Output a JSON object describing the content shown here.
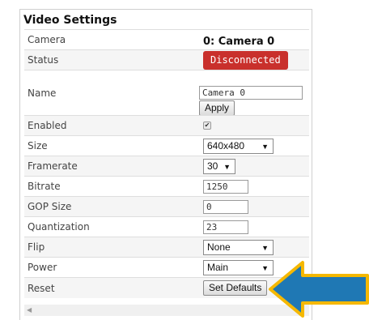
{
  "panel": {
    "title": "Video Settings",
    "rows": {
      "camera": {
        "label": "Camera",
        "value": "0: Camera 0"
      },
      "status": {
        "label": "Status",
        "value": "Disconnected"
      },
      "name": {
        "label": "Name",
        "value": "Camera 0",
        "apply_label": "Apply"
      },
      "enabled": {
        "label": "Enabled",
        "checked": true,
        "check_glyph": "✔"
      },
      "size": {
        "label": "Size",
        "value": "640x480"
      },
      "framerate": {
        "label": "Framerate",
        "value": "30"
      },
      "bitrate": {
        "label": "Bitrate",
        "value": "1250"
      },
      "gop": {
        "label": "GOP Size",
        "value": "0"
      },
      "quantization": {
        "label": "Quantization",
        "value": "23"
      },
      "flip": {
        "label": "Flip",
        "value": "None"
      },
      "power": {
        "label": "Power",
        "value": "Main"
      },
      "reset": {
        "label": "Reset",
        "button_label": "Set Defaults"
      }
    },
    "scroll_left_glyph": "◀",
    "dropdown_glyph": "▼"
  },
  "icons": {
    "dropdown": "chevron-down-icon",
    "checkbox": "checkmark-icon",
    "scroll": "scroll-left-icon",
    "annotation": "arrow-left-icon"
  },
  "colors": {
    "status_badge": "#c9302c",
    "arrow_fill": "#1f78b4",
    "arrow_outline": "#f5b800"
  }
}
